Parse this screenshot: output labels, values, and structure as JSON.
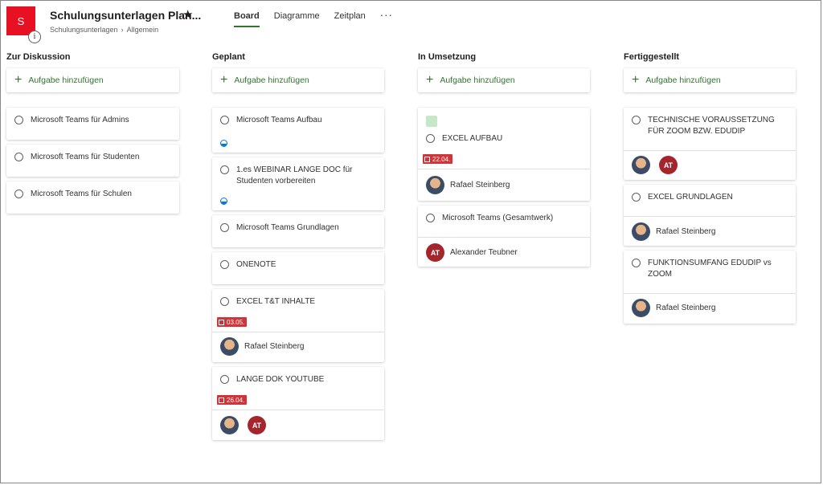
{
  "header": {
    "tile_letter": "S",
    "info_icon": "i",
    "title": "Schulungsunterlagen Plan...",
    "star_icon": "★",
    "breadcrumb": [
      "Schulungsunterlagen",
      "Allgemein"
    ],
    "breadcrumb_separator": "›",
    "tabs": [
      "Board",
      "Diagramme",
      "Zeitplan"
    ],
    "active_tab": "Board",
    "more_icon": "···"
  },
  "colors": {
    "accent": "#31752f",
    "tile": "#e81123",
    "due": "#d13438",
    "avatar_at": "#a4262c"
  },
  "add_label": "Aufgabe hinzufügen",
  "add_icon": "+",
  "columns": [
    {
      "title": "Zur Diskussion",
      "tasks": [
        {
          "title": "Microsoft Teams für Admins"
        },
        {
          "title": "Microsoft Teams für Studenten"
        },
        {
          "title": "Microsoft Teams für Schulen"
        }
      ]
    },
    {
      "title": "Geplant",
      "tasks": [
        {
          "title": "Microsoft Teams Aufbau",
          "progress": "in-progress"
        },
        {
          "title": "1.es WEBINAR LANGE DOC für Studenten vorbereiten",
          "progress": "in-progress"
        },
        {
          "title": "Microsoft Teams Grundlagen"
        },
        {
          "title": "ONENOTE"
        },
        {
          "title": "EXCEL T&T INHALTE",
          "due": "03.05.",
          "assignees": [
            {
              "type": "photo",
              "name": "Rafael Steinberg"
            }
          ]
        },
        {
          "title": "LANGE DOK YOUTUBE",
          "due": "26.04.",
          "assignees": [
            {
              "type": "photo"
            },
            {
              "type": "initials",
              "initials": "AT"
            }
          ]
        }
      ]
    },
    {
      "title": "In Umsetzung",
      "tasks": [
        {
          "title": "EXCEL AUFBAU",
          "label_color": "#c6e7c8",
          "due": "22.04.",
          "assignees": [
            {
              "type": "photo",
              "name": "Rafael Steinberg"
            }
          ]
        },
        {
          "title": "Microsoft Teams (Gesamtwerk)",
          "assignees": [
            {
              "type": "initials",
              "initials": "AT",
              "name": "Alexander Teubner"
            }
          ]
        }
      ]
    },
    {
      "title": "Fertiggestellt",
      "tasks": [
        {
          "title": "TECHNISCHE VORAUSSETZUNG FÜR ZOOM BZW. EDUDIP",
          "assignees": [
            {
              "type": "photo"
            },
            {
              "type": "initials",
              "initials": "AT"
            }
          ]
        },
        {
          "title": "EXCEL GRUNDLAGEN",
          "assignees": [
            {
              "type": "photo",
              "name": "Rafael Steinberg"
            }
          ]
        },
        {
          "title": "FUNKTIONSUMFANG EDUDIP vs ZOOM",
          "assignees": [
            {
              "type": "photo",
              "name": "Rafael Steinberg"
            }
          ]
        }
      ]
    }
  ]
}
